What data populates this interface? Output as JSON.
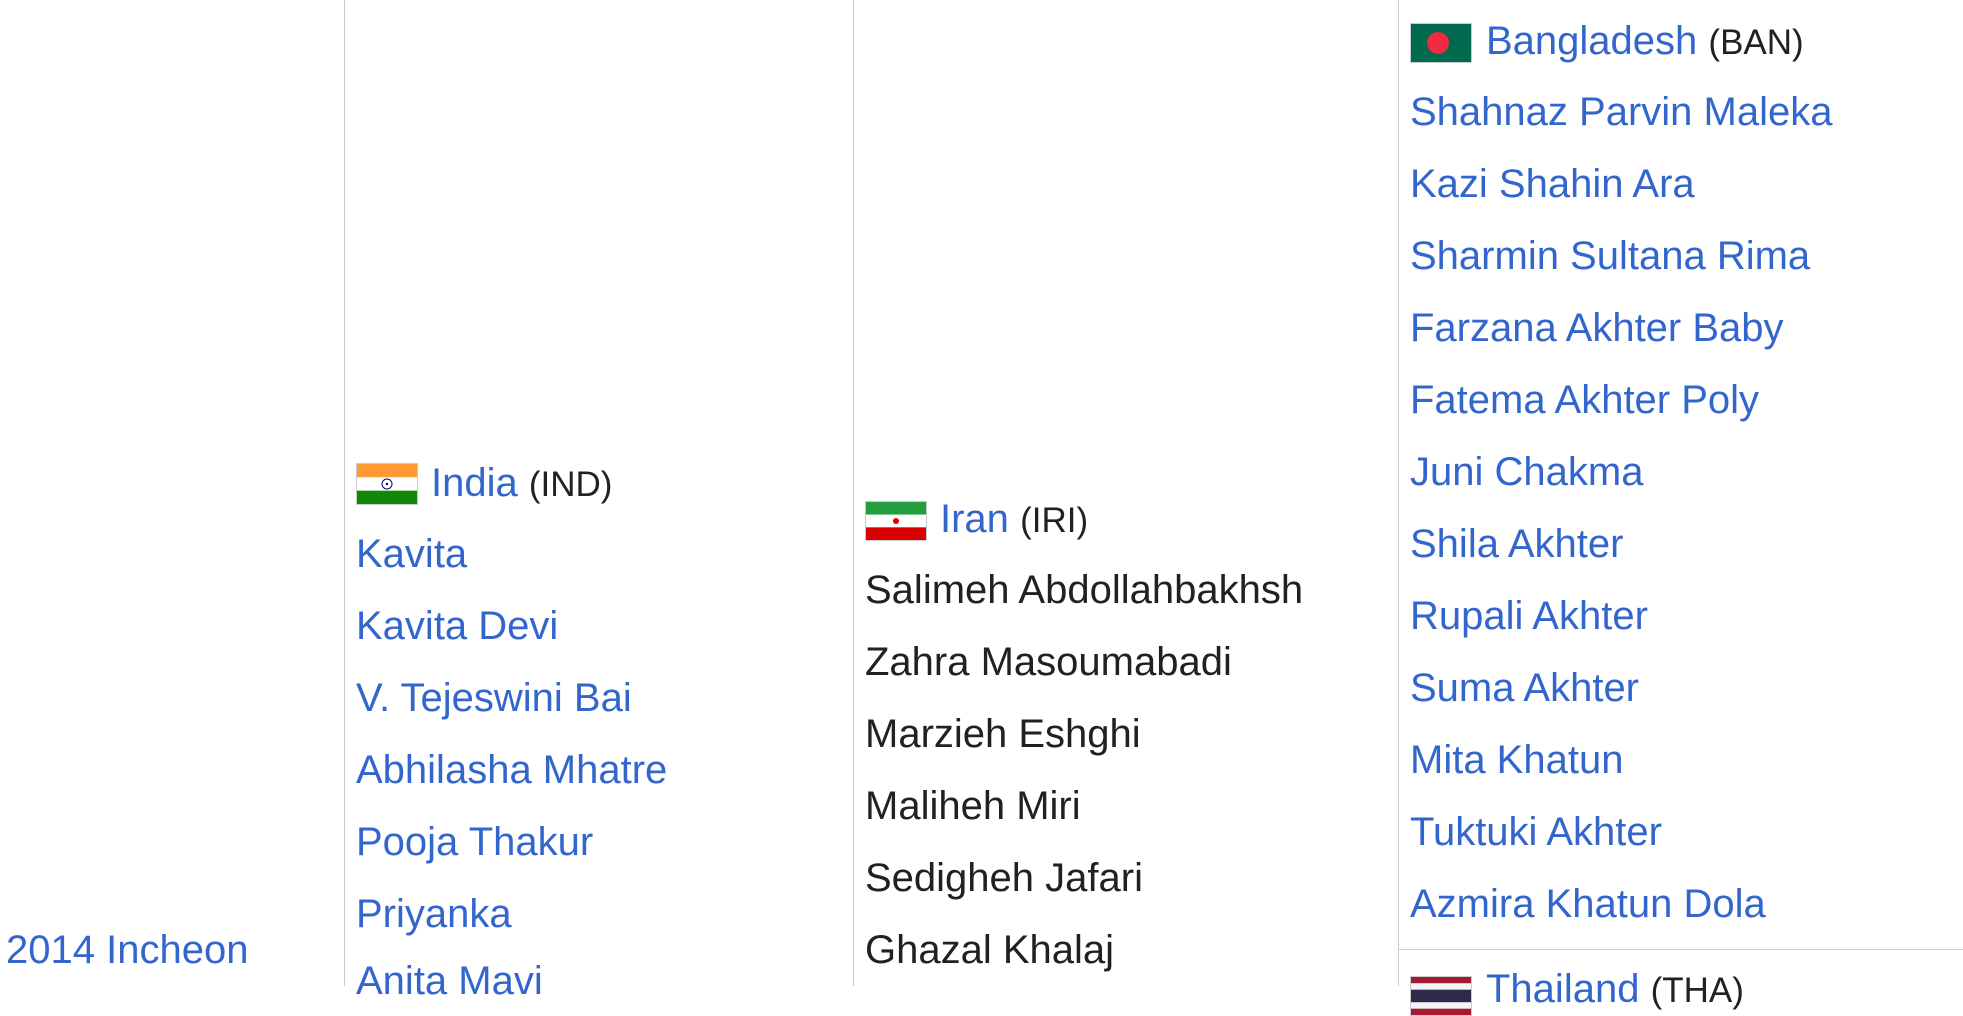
{
  "event": {
    "year_link": "2014 Incheon"
  },
  "india": {
    "country_link": "India",
    "code": "(IND)",
    "flag_icon": "india-flag-icon",
    "players": [
      "Kavita",
      "Kavita Devi",
      "V. Tejeswini Bai",
      "Abhilasha Mhatre",
      "Pooja Thakur",
      "Priyanka",
      "Anita Mavi"
    ]
  },
  "iran": {
    "country_link": "Iran",
    "code": "(IRI)",
    "flag_icon": "iran-flag-icon",
    "players": [
      "Salimeh Abdollahbakhsh",
      "Zahra Masoumabadi",
      "Marzieh Eshghi",
      "Maliheh Miri",
      "Sedigheh Jafari",
      "Ghazal Khalaj"
    ]
  },
  "bangladesh": {
    "country_link": "Bangladesh",
    "code": "(BAN)",
    "flag_icon": "bangladesh-flag-icon",
    "players": [
      "Shahnaz Parvin Maleka",
      "Kazi Shahin Ara",
      "Sharmin Sultana Rima",
      "Farzana Akhter Baby",
      "Fatema Akhter Poly",
      "Juni Chakma",
      "Shila Akhter",
      "Rupali Akhter",
      "Suma Akhter",
      "Mita Khatun",
      "Tuktuki Akhter",
      "Azmira Khatun Dola"
    ]
  },
  "thailand": {
    "country_link": "Thailand",
    "code": "(THA)",
    "flag_icon": "thailand-flag-icon"
  },
  "colors": {
    "link": "#3366cc",
    "text": "#202122",
    "border": "#c8ccd1"
  }
}
